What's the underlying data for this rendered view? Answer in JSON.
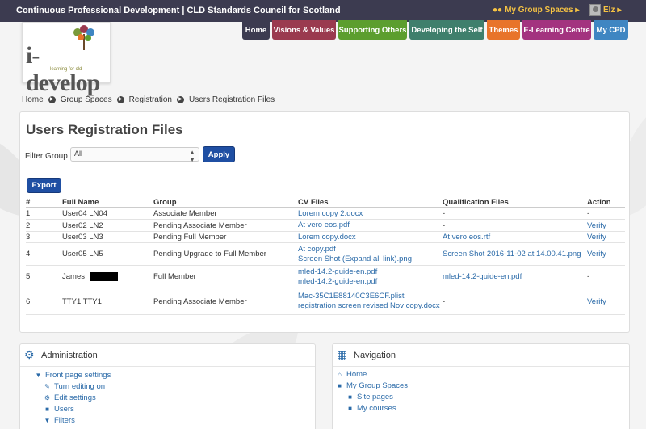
{
  "topbar": {
    "site_title": "Continuous Professional Development | CLD Standards Council for Scotland",
    "spaces_label": "My Group Spaces",
    "user_label": "Elz"
  },
  "logo": {
    "word": "i-develop",
    "tagline": "learning for cld"
  },
  "nav": [
    {
      "label": "Home",
      "color": "#3c3b50"
    },
    {
      "label": "Visions & Values",
      "color": "#9a3a4f"
    },
    {
      "label": "Supporting Others",
      "color": "#5c9e2e"
    },
    {
      "label": "Developing the Self",
      "color": "#3f7f6c"
    },
    {
      "label": "Themes",
      "color": "#e8742a"
    },
    {
      "label": "E-Learning Centre",
      "color": "#a3337f"
    },
    {
      "label": "My CPD",
      "color": "#3f86c2"
    }
  ],
  "breadcrumb": [
    "Home",
    "Group Spaces",
    "Registration",
    "Users Registration Files"
  ],
  "page": {
    "title": "Users Registration Files",
    "filter_label": "Filter Group",
    "filter_value": "All",
    "apply_label": "Apply",
    "export_label": "Export"
  },
  "table": {
    "headers": [
      "#",
      "Full Name",
      "Group",
      "CV Files",
      "Qualification Files",
      "Action"
    ],
    "rows": [
      {
        "num": "1",
        "name": "User04 LN04",
        "group": "Associate Member",
        "cv": [
          "Lorem copy 2.docx"
        ],
        "qual": "-",
        "qual_link": false,
        "action": "-",
        "action_link": false
      },
      {
        "num": "2",
        "name": "User02 LN2",
        "group": "Pending Associate Member",
        "cv": [
          "At vero eos.pdf"
        ],
        "qual": "-",
        "qual_link": false,
        "action": "Verify",
        "action_link": true
      },
      {
        "num": "3",
        "name": "User03 LN3",
        "group": "Pending Full Member",
        "cv": [
          "Lorem copy.docx"
        ],
        "qual": "At vero eos.rtf",
        "qual_link": true,
        "action": "Verify",
        "action_link": true
      },
      {
        "num": "4",
        "name": "User05 LN5",
        "group": "Pending Upgrade to Full Member",
        "cv": [
          "At copy.pdf",
          "Screen Shot (Expand all link).png"
        ],
        "qual": "Screen Shot 2016-11-02 at 14.00.41.png",
        "qual_link": true,
        "action": "Verify",
        "action_link": true
      },
      {
        "num": "5",
        "name": "James",
        "redacted": true,
        "group": "Full Member",
        "cv": [
          "mled-14.2-guide-en.pdf",
          "mled-14.2-guide-en.pdf"
        ],
        "qual": "mled-14.2-guide-en.pdf",
        "qual_link": true,
        "action": "-",
        "action_link": false
      },
      {
        "num": "6",
        "name": "TTY1 TTY1",
        "group": "Pending Associate Member",
        "cv": [
          "Mac-35C1E88140C3E6CF.plist",
          "registration screen revised Nov copy.docx"
        ],
        "qual": "-",
        "qual_link": false,
        "action": "Verify",
        "action_link": true
      }
    ]
  },
  "admin_block": {
    "title": "Administration",
    "items": [
      "Front page settings",
      "Turn editing on",
      "Edit settings",
      "Users",
      "Filters"
    ]
  },
  "navigation_block": {
    "title": "Navigation",
    "items": [
      "Home",
      "My Group Spaces",
      "Site pages",
      "My courses"
    ]
  }
}
